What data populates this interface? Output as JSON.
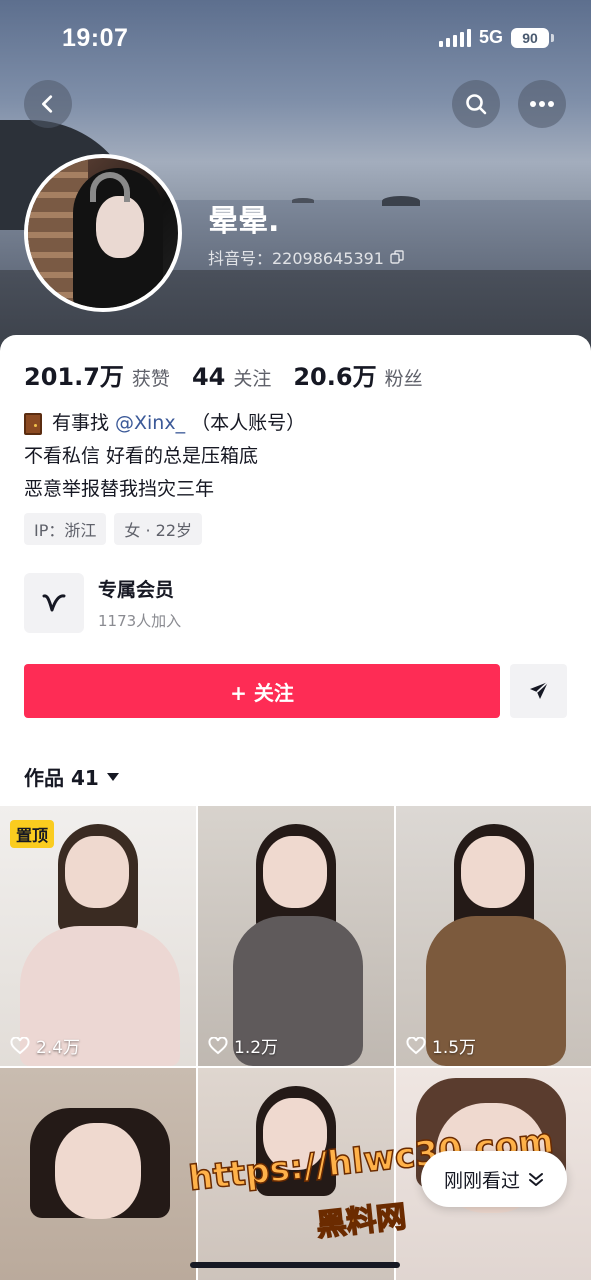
{
  "status_bar": {
    "time": "19:07",
    "network": "5G",
    "battery": "90"
  },
  "profile": {
    "nickname": "晕晕.",
    "douyin_id": "抖音号：22098645391"
  },
  "stats": [
    {
      "value": "201.7万",
      "label": "获赞"
    },
    {
      "value": "44",
      "label": "关注"
    },
    {
      "value": "20.6万",
      "label": "粉丝"
    }
  ],
  "bio": {
    "line1_prefix": "有事找",
    "line1_mention": "@Xinx_",
    "line1_suffix": "（本人账号）",
    "line2": "不看私信 好看的总是压箱底",
    "line3": "恶意举报替我挡灾三年"
  },
  "tags": [
    "IP：浙江",
    "女 · 22岁"
  ],
  "membership": {
    "title": "专属会员",
    "subtitle": "1173人加入"
  },
  "actions": {
    "follow_label": "+ 关注"
  },
  "works": {
    "label": "作品 41",
    "items": [
      {
        "pinned": "置顶",
        "likes": "2.4万",
        "bg": "#e9e6e2"
      },
      {
        "pinned": "",
        "likes": "1.2万",
        "bg": "#d7d2cc"
      },
      {
        "pinned": "",
        "likes": "1.5万",
        "bg": "#d9d4ce"
      },
      {
        "pinned": "",
        "likes": "",
        "bg": "#c7b8ab"
      },
      {
        "pinned": "",
        "likes": "",
        "bg": "#d9cfc7"
      },
      {
        "pinned": "",
        "likes": "",
        "bg": "#e7ddd8"
      }
    ]
  },
  "recent": {
    "label": "刚刚看过"
  },
  "watermark": {
    "url": "https://hlwc30.com",
    "name": "黑料网"
  },
  "colors": {
    "accent": "#fe2c55",
    "pin_badge": "#facc1f"
  }
}
